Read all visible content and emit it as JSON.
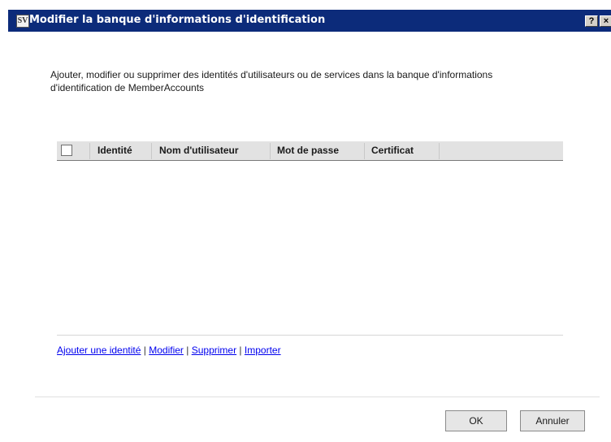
{
  "window": {
    "title": "Modifier la banque d'informations d'identification",
    "app_icon_text": "SV",
    "help_label": "?",
    "close_label": "×"
  },
  "description": "Ajouter, modifier ou supprimer des identités d'utilisateurs ou de services dans la banque d'informations d'identification de MemberAccounts",
  "table": {
    "columns": [
      "Identité",
      "Nom d'utilisateur",
      "Mot de passe",
      "Certificat"
    ],
    "rows": []
  },
  "actions": {
    "add": "Ajouter une identité",
    "edit": "Modifier",
    "delete": "Supprimer",
    "import": "Importer",
    "separator": "|"
  },
  "buttons": {
    "ok": "OK",
    "cancel": "Annuler"
  }
}
